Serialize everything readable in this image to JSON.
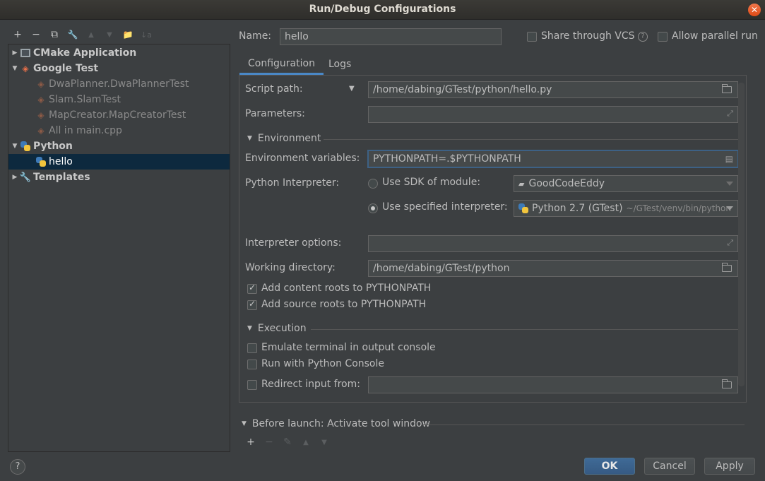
{
  "window": {
    "title": "Run/Debug Configurations",
    "close_glyph": "✕"
  },
  "toolbar": {
    "add": "+",
    "remove": "−",
    "copy": "⧉",
    "edit": "🔧",
    "up": "▲",
    "down": "▼",
    "folder": "📁",
    "sort": "↓a"
  },
  "tree": {
    "items": [
      {
        "label": "CMake Application",
        "arrow": "▶"
      },
      {
        "label": "Google Test",
        "arrow": "▼"
      },
      {
        "label": "DwaPlanner.DwaPlannerTest"
      },
      {
        "label": "Slam.SlamTest"
      },
      {
        "label": "MapCreator.MapCreatorTest"
      },
      {
        "label": "All in main.cpp"
      },
      {
        "label": "Python",
        "arrow": "▼"
      },
      {
        "label": "hello"
      },
      {
        "label": "Templates",
        "arrow": "▶"
      }
    ]
  },
  "header": {
    "name_label": "Name:",
    "name_value": "hello",
    "share_vcs": "Share through VCS",
    "allow_parallel": "Allow parallel run"
  },
  "tabs": [
    {
      "label": "Configuration"
    },
    {
      "label": "Logs"
    }
  ],
  "form": {
    "script_path_label": "Script path:",
    "script_path_value": "/home/dabing/GTest/python/hello.py",
    "parameters_label": "Parameters:",
    "environment_section": "Environment",
    "env_vars_label": "Environment variables:",
    "env_vars_value": "PYTHONPATH=.$PYTHONPATH",
    "interpreter_label": "Python Interpreter:",
    "use_sdk_label": "Use SDK of module:",
    "sdk_module_value": "GoodCodeEddy",
    "use_specified_label": "Use specified interpreter:",
    "interpreter_value": "Python 2.7 (GTest)",
    "interpreter_path": "~/GTest/venv/bin/python",
    "interp_options_label": "Interpreter options:",
    "working_dir_label": "Working directory:",
    "working_dir_value": "/home/dabing/GTest/python",
    "add_content_roots": "Add content roots to PYTHONPATH",
    "add_source_roots": "Add source roots to PYTHONPATH",
    "execution_section": "Execution",
    "emulate_terminal": "Emulate terminal in output console",
    "run_python_console": "Run with Python Console",
    "redirect_input": "Redirect input from:"
  },
  "before_launch": {
    "title": "Before launch: Activate tool window",
    "add": "+",
    "remove": "−",
    "edit": "✎",
    "up": "▲",
    "down": "▼"
  },
  "footer": {
    "help": "?",
    "ok": "OK",
    "cancel": "Cancel",
    "apply": "Apply"
  },
  "colors": {
    "background": "#3c3f41",
    "selection": "#0d293e",
    "accent": "#4a88c7",
    "primary_button": "#365a83"
  }
}
